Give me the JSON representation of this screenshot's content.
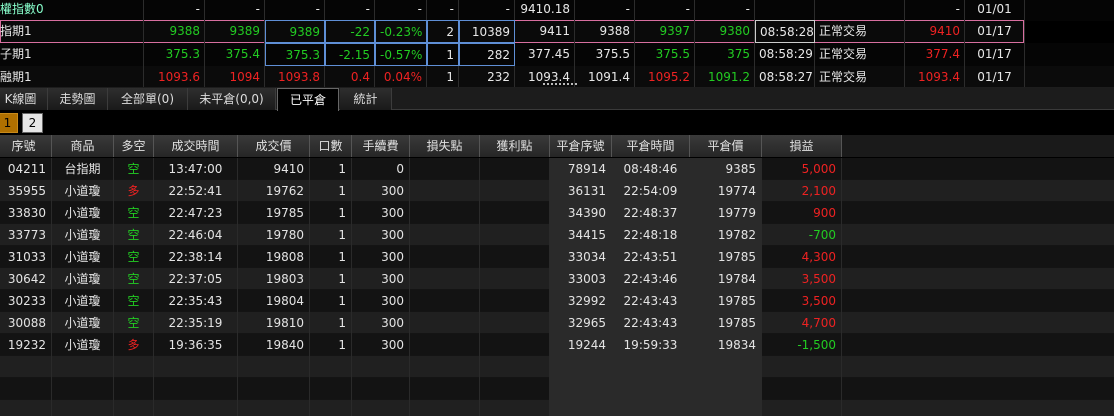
{
  "quotes": [
    {
      "product": "權指數0",
      "bid": "-",
      "ask": "-",
      "last": "-",
      "change": "-",
      "pct": "-",
      "single": "-",
      "volume": "-",
      "open": "9410.18",
      "high": "-",
      "low": "-",
      "prevclose": "-",
      "time": "",
      "status": "",
      "ref": "-",
      "date": "01/01"
    },
    {
      "product": "指期1",
      "bid": "9388",
      "ask": "9389",
      "last": "9389",
      "change": "-22",
      "pct": "-0.23%",
      "single": "2",
      "volume": "10389",
      "open": "9411",
      "high": "9388",
      "low": "9397",
      "prevclose": "9380",
      "time": "08:58:28",
      "status": "正常交易",
      "ref": "9410",
      "date": "01/17"
    },
    {
      "product": "子期1",
      "bid": "375.3",
      "ask": "375.4",
      "last": "375.3",
      "change": "-2.15",
      "pct": "-0.57%",
      "single": "1",
      "volume": "282",
      "open": "377.45",
      "high": "375.5",
      "low": "375.5",
      "prevclose": "375",
      "time": "08:58:29",
      "status": "正常交易",
      "ref": "377.4",
      "date": "01/17"
    },
    {
      "product": "融期1",
      "bid": "1093.6",
      "ask": "1094",
      "last": "1093.8",
      "change": "0.4",
      "pct": "0.04%",
      "single": "1",
      "volume": "232",
      "open": "1093.4",
      "high": "1091.4",
      "low": "1095.2",
      "prevclose": "1091.2",
      "time": "08:58:27",
      "status": "正常交易",
      "ref": "1093.4",
      "date": "01/17"
    }
  ],
  "tabs": [
    "K線圖",
    "走勢圖",
    "全部單(0)",
    "未平倉(0,0)",
    "已平倉",
    "統計"
  ],
  "active_tab": "已平倉",
  "pages": [
    "1",
    "2"
  ],
  "columns": [
    "序號",
    "商品",
    "多空",
    "成交時間",
    "成交價",
    "口數",
    "手續費",
    "損失點",
    "獲利點",
    "平倉序號",
    "平倉時間",
    "平倉價",
    "損益"
  ],
  "rows": [
    {
      "id": "04211",
      "product": "台指期",
      "side": "空",
      "time": "13:47:00",
      "price": "9410",
      "qty": "1",
      "fee": "0",
      "loss": "",
      "profit": "",
      "close_id": "78914",
      "close_time": "08:48:46",
      "close_price": "9385",
      "pnl": "5,000"
    },
    {
      "id": "35955",
      "product": "小道瓊",
      "side": "多",
      "time": "22:52:41",
      "price": "19762",
      "qty": "1",
      "fee": "300",
      "loss": "",
      "profit": "",
      "close_id": "36131",
      "close_time": "22:54:09",
      "close_price": "19774",
      "pnl": "2,100"
    },
    {
      "id": "33830",
      "product": "小道瓊",
      "side": "空",
      "time": "22:47:23",
      "price": "19785",
      "qty": "1",
      "fee": "300",
      "loss": "",
      "profit": "",
      "close_id": "34390",
      "close_time": "22:48:37",
      "close_price": "19779",
      "pnl": "900"
    },
    {
      "id": "33773",
      "product": "小道瓊",
      "side": "空",
      "time": "22:46:04",
      "price": "19780",
      "qty": "1",
      "fee": "300",
      "loss": "",
      "profit": "",
      "close_id": "34415",
      "close_time": "22:48:18",
      "close_price": "19782",
      "pnl": "-700"
    },
    {
      "id": "31033",
      "product": "小道瓊",
      "side": "空",
      "time": "22:38:14",
      "price": "19808",
      "qty": "1",
      "fee": "300",
      "loss": "",
      "profit": "",
      "close_id": "33034",
      "close_time": "22:43:51",
      "close_price": "19785",
      "pnl": "4,300"
    },
    {
      "id": "30642",
      "product": "小道瓊",
      "side": "空",
      "time": "22:37:05",
      "price": "19803",
      "qty": "1",
      "fee": "300",
      "loss": "",
      "profit": "",
      "close_id": "33003",
      "close_time": "22:43:46",
      "close_price": "19784",
      "pnl": "3,500"
    },
    {
      "id": "30233",
      "product": "小道瓊",
      "side": "空",
      "time": "22:35:43",
      "price": "19804",
      "qty": "1",
      "fee": "300",
      "loss": "",
      "profit": "",
      "close_id": "32992",
      "close_time": "22:43:43",
      "close_price": "19785",
      "pnl": "3,500"
    },
    {
      "id": "30088",
      "product": "小道瓊",
      "side": "空",
      "time": "22:35:19",
      "price": "19810",
      "qty": "1",
      "fee": "300",
      "loss": "",
      "profit": "",
      "close_id": "32965",
      "close_time": "22:43:43",
      "close_price": "19785",
      "pnl": "4,700"
    },
    {
      "id": "19232",
      "product": "小道瓊",
      "side": "多",
      "time": "19:36:35",
      "price": "19840",
      "qty": "1",
      "fee": "300",
      "loss": "",
      "profit": "",
      "close_id": "19244",
      "close_time": "19:59:33",
      "close_price": "19834",
      "pnl": "-1,500"
    }
  ],
  "colors": {
    "up": "#ee2222",
    "down": "#22cc22",
    "long": "#ee2222",
    "short": "#22cc22",
    "highlight": "#5f8fd6",
    "active_page": "#b07000"
  }
}
